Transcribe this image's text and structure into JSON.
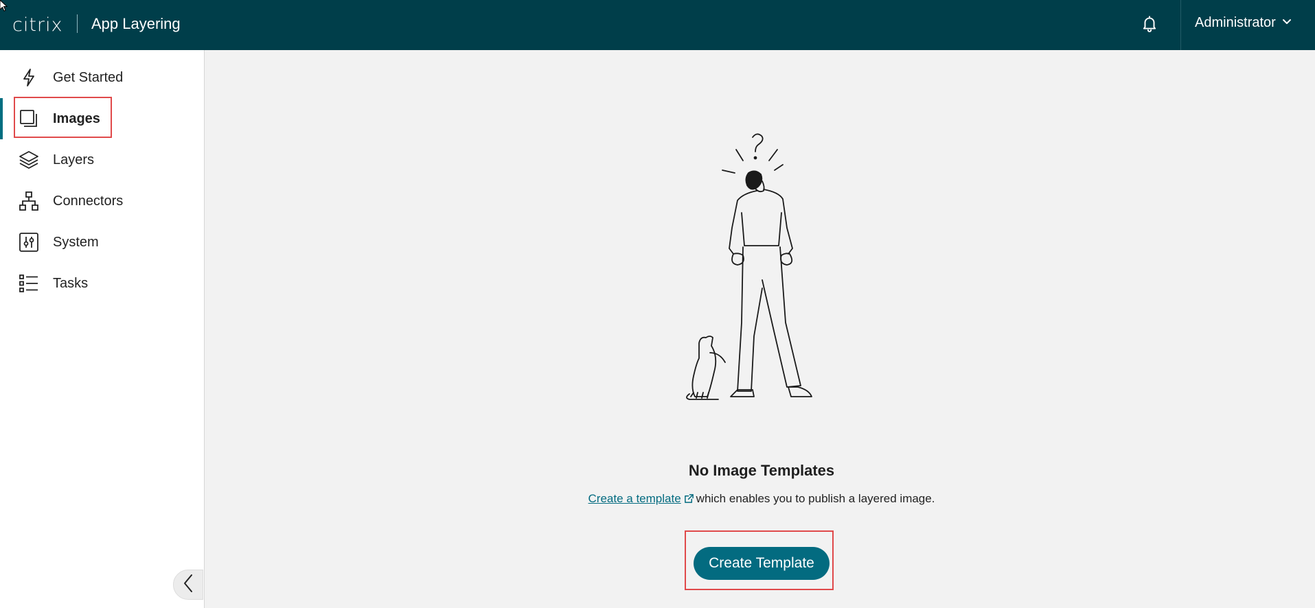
{
  "header": {
    "logo_text": "citrix",
    "app_title": "App Layering",
    "notifications_icon": "bell-icon",
    "user_name": "Administrator",
    "user_menu_icon": "chevron-down-icon"
  },
  "sidebar": {
    "items": [
      {
        "label": "Get Started",
        "icon": "lightning-icon",
        "active": false
      },
      {
        "label": "Images",
        "icon": "images-stack-icon",
        "active": true
      },
      {
        "label": "Layers",
        "icon": "layers-icon",
        "active": false
      },
      {
        "label": "Connectors",
        "icon": "network-icon",
        "active": false
      },
      {
        "label": "System",
        "icon": "sliders-icon",
        "active": false
      },
      {
        "label": "Tasks",
        "icon": "task-list-icon",
        "active": false
      }
    ],
    "collapse_icon": "chevron-left-icon"
  },
  "main": {
    "empty_state": {
      "illustration": "confused-person-with-empty-pockets-and-cat-illustration",
      "title": "No Image Templates",
      "link_text": "Create a template",
      "link_icon": "external-link-icon",
      "message_suffix": "which enables you to publish a layered image.",
      "button_label": "Create Template"
    }
  },
  "colors": {
    "header_bg": "#003e4a",
    "accent": "#036b80",
    "highlight": "#e0494a",
    "main_bg": "#f2f2f2"
  }
}
